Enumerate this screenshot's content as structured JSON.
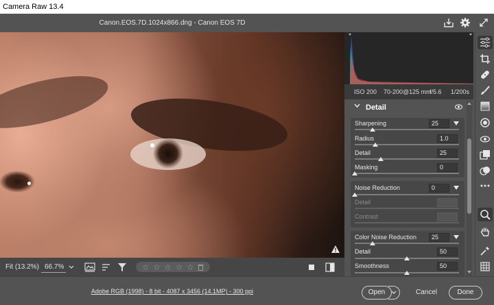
{
  "window": {
    "title": "Camera Raw 13.4"
  },
  "header": {
    "file_title": "Canon.EOS.7D.1024x866.dng  -  Canon EOS 7D",
    "icons": [
      "save-icon",
      "gear-icon",
      "fullscreen-icon"
    ]
  },
  "metadata": {
    "iso": "ISO 200",
    "lens": "70-200@125 mm",
    "aperture": "f/5.6",
    "shutter": "1/200s"
  },
  "detail_panel": {
    "title": "Detail",
    "sharpening": {
      "label": "Sharpening",
      "value": "25",
      "sliders": [
        {
          "label": "Radius",
          "value": "1.0"
        },
        {
          "label": "Detail",
          "value": "25"
        },
        {
          "label": "Masking",
          "value": "0"
        }
      ]
    },
    "noise_reduction": {
      "label": "Noise Reduction",
      "value": "0",
      "sliders": [
        {
          "label": "Detail",
          "value": ""
        },
        {
          "label": "Contrast",
          "value": ""
        }
      ]
    },
    "color_noise_reduction": {
      "label": "Color Noise Reduction",
      "value": "25",
      "sliders": [
        {
          "label": "Detail",
          "value": "50"
        },
        {
          "label": "Smoothness",
          "value": "50"
        }
      ]
    }
  },
  "image_toolbar": {
    "fit_label": "Fit (13.2%)",
    "zoom_label": "66.7%",
    "rating_stars": 5,
    "rating_value": 0
  },
  "footer": {
    "workflow_text": "Adobe RGB (1998) - 8 bit - 4087 x 3456 (14.1MP) - 300 ppi",
    "open_label": "Open",
    "cancel_label": "Cancel",
    "done_label": "Done"
  },
  "tools": [
    "edit-icon",
    "crop-icon",
    "healing-icon",
    "brush-icon",
    "graduated-filter-icon",
    "radial-filter-icon",
    "red-eye-icon",
    "snapshots-icon",
    "presets-icon",
    "more-icon",
    "zoom-icon",
    "hand-icon",
    "color-sampler-icon",
    "grid-icon"
  ],
  "colors": {
    "accent": "#e6e6e6",
    "panel": "#535353",
    "section": "#474747"
  }
}
